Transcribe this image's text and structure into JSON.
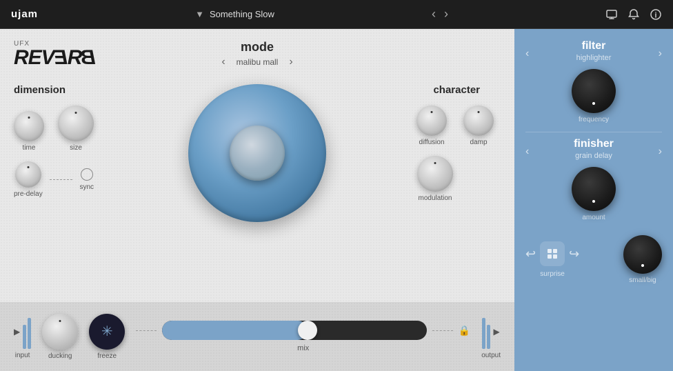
{
  "topbar": {
    "brand": "ujam",
    "preset_name": "Something Slow",
    "nav_prev": "‹",
    "nav_next": "›"
  },
  "plugin": {
    "ufx_label": "UFX",
    "logo": "REVERB",
    "mode": {
      "label": "mode",
      "value": "malibu mall",
      "prev_arrow": "‹",
      "next_arrow": "›"
    },
    "dimension": {
      "label": "dimension",
      "time_label": "time",
      "size_label": "size",
      "pre_delay_label": "pre-delay",
      "sync_label": "sync"
    },
    "character": {
      "label": "character",
      "diffusion_label": "diffusion",
      "damp_label": "damp",
      "modulation_label": "modulation"
    },
    "bottom": {
      "input_label": "input",
      "ducking_label": "ducking",
      "freeze_label": "freeze",
      "mix_label": "mix",
      "output_label": "output"
    }
  },
  "right_panel": {
    "filter": {
      "title": "filter",
      "sub": "highlighter",
      "freq_label": "frequency",
      "prev": "‹",
      "next": "›"
    },
    "finisher": {
      "title": "finisher",
      "sub": "grain delay",
      "amount_label": "amount",
      "prev": "‹",
      "next": "›"
    },
    "bottom": {
      "undo": "↩",
      "redo": "↪",
      "surprise_label": "surprise",
      "small_big_label": "small/big"
    }
  }
}
